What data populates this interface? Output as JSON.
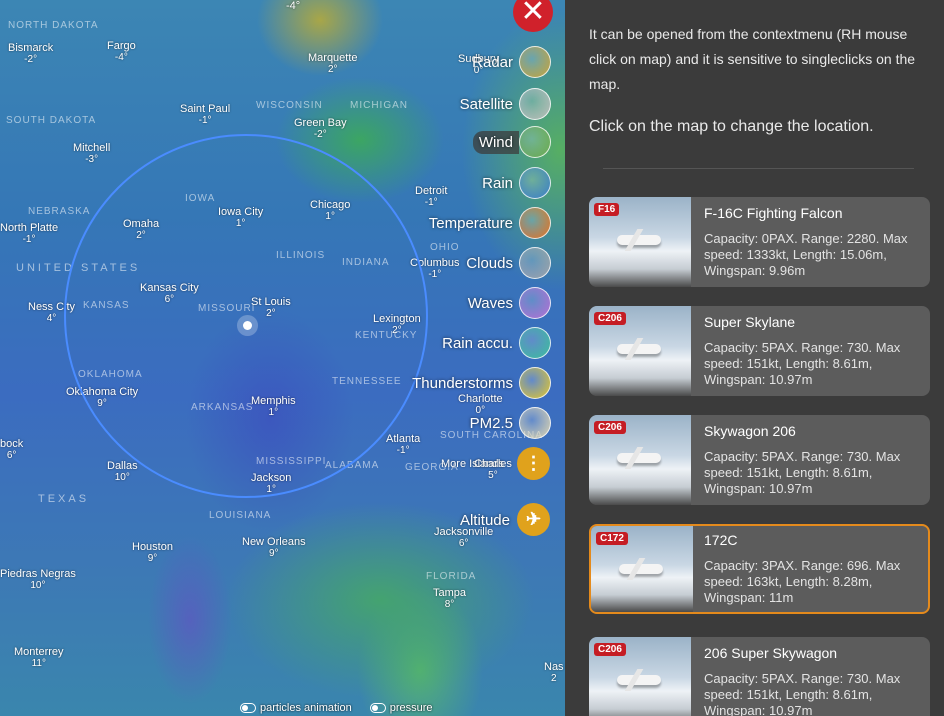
{
  "map": {
    "places": [
      {
        "name": "NORTH DAKOTA",
        "temp": "",
        "region": true
      },
      {
        "name": "Bismarck",
        "temp": "-2°"
      },
      {
        "name": "Fargo",
        "temp": "-4°"
      },
      {
        "name": "SOUTH DAKOTA",
        "temp": "",
        "region": true
      },
      {
        "name": "Saint Paul",
        "temp": "-1°"
      },
      {
        "name": "Marquette",
        "temp": "2°"
      },
      {
        "name": "Sudbury",
        "temp": "0°"
      },
      {
        "name": "WISCONSIN",
        "temp": "",
        "region": true
      },
      {
        "name": "MICHIGAN",
        "temp": "",
        "region": true
      },
      {
        "name": "Mitchell",
        "temp": "-3°"
      },
      {
        "name": "Green Bay",
        "temp": "-2°"
      },
      {
        "name": "NEBRASKA",
        "temp": "",
        "region": true
      },
      {
        "name": "IOWA",
        "temp": "",
        "region": true
      },
      {
        "name": "Omaha",
        "temp": "2°"
      },
      {
        "name": "Iowa City",
        "temp": "1°"
      },
      {
        "name": "Chicago",
        "temp": "1°"
      },
      {
        "name": "Detroit",
        "temp": "-1°"
      },
      {
        "name": "North Platte",
        "temp": "-1°"
      },
      {
        "name": "OHIO",
        "temp": "",
        "region": true
      },
      {
        "name": "UNITED STATES",
        "temp": "",
        "region": true
      },
      {
        "name": "ILLINOIS",
        "temp": "",
        "region": true
      },
      {
        "name": "INDIANA",
        "temp": "",
        "region": true
      },
      {
        "name": "Columbus",
        "temp": "-1°"
      },
      {
        "name": "Kansas City",
        "temp": "6°"
      },
      {
        "name": "Ness City",
        "temp": "4°"
      },
      {
        "name": "KANSAS",
        "temp": "",
        "region": true
      },
      {
        "name": "MISSOURI",
        "temp": "",
        "region": true
      },
      {
        "name": "St Louis",
        "temp": "2°"
      },
      {
        "name": "Lexington",
        "temp": "2°"
      },
      {
        "name": "KENTUCKY",
        "temp": "",
        "region": true
      },
      {
        "name": "OKLAHOMA",
        "temp": "",
        "region": true
      },
      {
        "name": "Oklahoma City",
        "temp": "9°"
      },
      {
        "name": "TENNESSEE",
        "temp": "",
        "region": true
      },
      {
        "name": "ARKANSAS",
        "temp": "",
        "region": true
      },
      {
        "name": "Memphis",
        "temp": "1°"
      },
      {
        "name": "Charlotte",
        "temp": "0°"
      },
      {
        "name": "SOUTH CAROLINA",
        "temp": "",
        "region": true
      },
      {
        "name": "bock",
        "temp": "6°"
      },
      {
        "name": "Atlanta",
        "temp": "-1°"
      },
      {
        "name": "Dallas",
        "temp": "10°"
      },
      {
        "name": "MISSISSIPPI",
        "temp": "",
        "region": true
      },
      {
        "name": "ALABAMA",
        "temp": "",
        "region": true
      },
      {
        "name": "GEORGIA",
        "temp": "",
        "region": true
      },
      {
        "name": "More Islands",
        "temp": ""
      },
      {
        "name": "Charles",
        "temp": "5°"
      },
      {
        "name": "TEXAS",
        "temp": "",
        "region": true
      },
      {
        "name": "Jackson",
        "temp": "1°"
      },
      {
        "name": "LOUISIANA",
        "temp": "",
        "region": true
      },
      {
        "name": "Jacksonville",
        "temp": "6°"
      },
      {
        "name": "Houston",
        "temp": "9°"
      },
      {
        "name": "New Orleans",
        "temp": "9°"
      },
      {
        "name": "Piedras Negras",
        "temp": "10°"
      },
      {
        "name": "FLORIDA",
        "temp": "",
        "region": true
      },
      {
        "name": "Tampa",
        "temp": "8°"
      },
      {
        "name": "Monterrey",
        "temp": "11°"
      },
      {
        "name": "Nas",
        "temp": "2"
      },
      {
        "name": "-4°",
        "temp": ""
      }
    ],
    "layers": [
      {
        "label": "Radar",
        "icon": "radar-thumbnail-icon",
        "thumb": "#c9a23a"
      },
      {
        "label": "Satellite",
        "icon": "satellite-thumbnail-icon",
        "thumb": "#bdbdbd"
      },
      {
        "label": "Wind",
        "icon": "wind-thumbnail-icon",
        "thumb": "#6aa84f",
        "active": true
      },
      {
        "label": "Rain",
        "icon": "rain-thumbnail-icon",
        "thumb": "#3a7dc9"
      },
      {
        "label": "Temperature",
        "icon": "temperature-thumbnail-icon",
        "thumb": "#e8711e"
      },
      {
        "label": "Clouds",
        "icon": "clouds-thumbnail-icon",
        "thumb": "#a0a4a8"
      },
      {
        "label": "Waves",
        "icon": "waves-thumbnail-icon",
        "thumb": "#b66fd4"
      },
      {
        "label": "Rain accu.",
        "icon": "rain-accumulation-thumbnail-icon",
        "thumb": "#3bbf9b"
      },
      {
        "label": "Thunderstorms",
        "icon": "thunderstorms-thumbnail-icon",
        "thumb": "#e5c92a"
      },
      {
        "label": "PM2.5",
        "icon": "pm25-thumbnail-icon",
        "thumb": "#e0d6b0"
      }
    ],
    "altitude_label": "Altitude",
    "close_glyph": "✕",
    "more_glyph": "⋮",
    "plane_glyph": "✈",
    "bottom": {
      "particles": "particles animation",
      "pressure": "pressure"
    }
  },
  "panel": {
    "help_top": "",
    "help_context": "It can be opened from the contextmenu (RH mouse click on map) and it is sensitive to singleclicks on the map.",
    "help_click": "Click on the map to change the location.",
    "aircraft": [
      {
        "badge": "F16",
        "title": "F-16C Fighting Falcon",
        "desc": "Capacity: 0PAX. Range: 2280. Max speed: 1333kt, Length: 15.06m, Wingspan: 9.96m"
      },
      {
        "badge": "C206",
        "title": "Super Skylane",
        "desc": "Capacity: 5PAX. Range: 730. Max speed: 151kt, Length: 8.61m, Wingspan: 10.97m"
      },
      {
        "badge": "C206",
        "title": "Skywagon 206",
        "desc": "Capacity: 5PAX. Range: 730. Max speed: 151kt, Length: 8.61m, Wingspan: 10.97m"
      },
      {
        "badge": "C172",
        "title": "172C",
        "desc": "Capacity: 3PAX. Range: 696. Max speed: 163kt, Length: 8.28m, Wingspan: 11m",
        "selected": true
      },
      {
        "badge": "C206",
        "title": "206 Super Skywagon",
        "desc": "Capacity: 5PAX. Range: 730. Max speed: 151kt, Length: 8.61m, Wingspan: 10.97m"
      }
    ]
  }
}
